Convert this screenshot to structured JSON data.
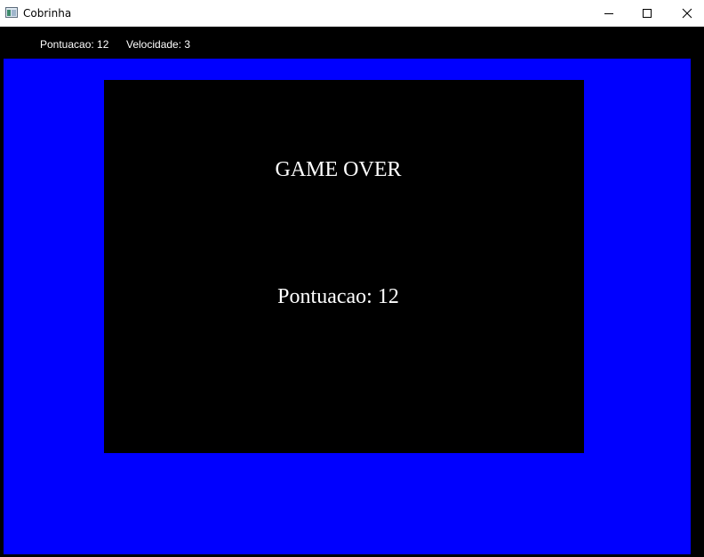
{
  "window": {
    "title": "Cobrinha",
    "icon": "app-window-icon",
    "controls": {
      "minimize_icon": "minimize-icon",
      "maximize_icon": "maximize-icon",
      "close_icon": "close-icon"
    }
  },
  "status": {
    "score_text": "Pontuacao: 12",
    "speed_text": "Velocidade: 3"
  },
  "game": {
    "field_color": "#0000ff",
    "panel_color": "#000000",
    "game_over_text": "GAME OVER",
    "final_score_text": "Pontuacao: 12"
  }
}
